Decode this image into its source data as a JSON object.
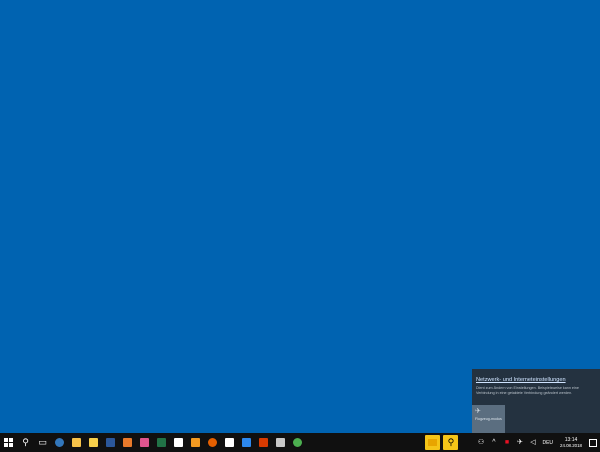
{
  "network_flyout": {
    "title": "Netzwerk- und Interneteinstellungen",
    "description": "Dient zum Ändern von Einstellungen. Beispielsweise kann eine Verbindung in eine getaktete Verbindung geändert werden.",
    "vpn_tile_label": "Flugzeug-modus"
  },
  "taskbar": {
    "apps": [
      {
        "name": "file-explorer",
        "color": "#f6c34a"
      },
      {
        "name": "sticky-notes",
        "color": "#f7d04c"
      },
      {
        "name": "word",
        "color": "#2b579a"
      },
      {
        "name": "notepad-orange",
        "color": "#e97a2b"
      },
      {
        "name": "paint",
        "color": "#e0558f"
      },
      {
        "name": "excel",
        "color": "#217346"
      },
      {
        "name": "chat",
        "color": "#ffffff"
      },
      {
        "name": "orange-app",
        "color": "#f39a21"
      },
      {
        "name": "firefox",
        "color": "#e66000"
      },
      {
        "name": "camera",
        "color": "#ffffff"
      },
      {
        "name": "mail",
        "color": "#2d89ef"
      },
      {
        "name": "acrobat",
        "color": "#d83b01"
      },
      {
        "name": "calculator",
        "color": "#c8c8c8"
      },
      {
        "name": "chrome",
        "color": "#4caf50"
      }
    ]
  },
  "tray": {
    "language": "DEU",
    "time": "13:14",
    "date": "24.08.2018"
  }
}
